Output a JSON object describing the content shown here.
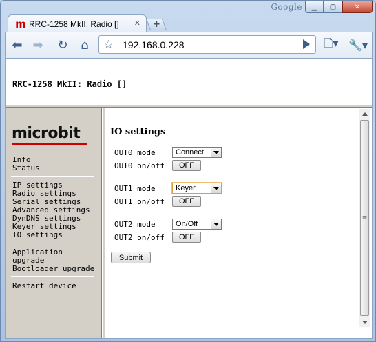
{
  "browser": {
    "brand_word": "Google",
    "tab_title": "RRC-1258 MkII: Radio []",
    "tab_favicon": "m",
    "url": "192.168.0.228"
  },
  "page": {
    "device_title": "RRC-1258 MkII: Radio []",
    "logo_text": "microbit",
    "nav_groups": [
      [
        "Info",
        "Status"
      ],
      [
        "IP settings",
        "Radio settings",
        "Serial settings",
        "Advanced settings",
        "DynDNS settings",
        "Keyer settings",
        "IO settings"
      ],
      [
        "Application upgrade",
        "Bootloader upgrade"
      ],
      [
        "Restart device"
      ]
    ],
    "section_title": "IO settings",
    "outputs": [
      {
        "mode_label": "OUT0 mode",
        "mode_value": "Connect",
        "onoff_label": "OUT0 on/off",
        "onoff_button": "OFF"
      },
      {
        "mode_label": "OUT1 mode",
        "mode_value": "Keyer",
        "onoff_label": "OUT1 on/off",
        "onoff_button": "OFF"
      },
      {
        "mode_label": "OUT2 mode",
        "mode_value": "On/Off",
        "onoff_label": "OUT2 on/off",
        "onoff_button": "OFF"
      }
    ],
    "submit_label": "Submit"
  }
}
